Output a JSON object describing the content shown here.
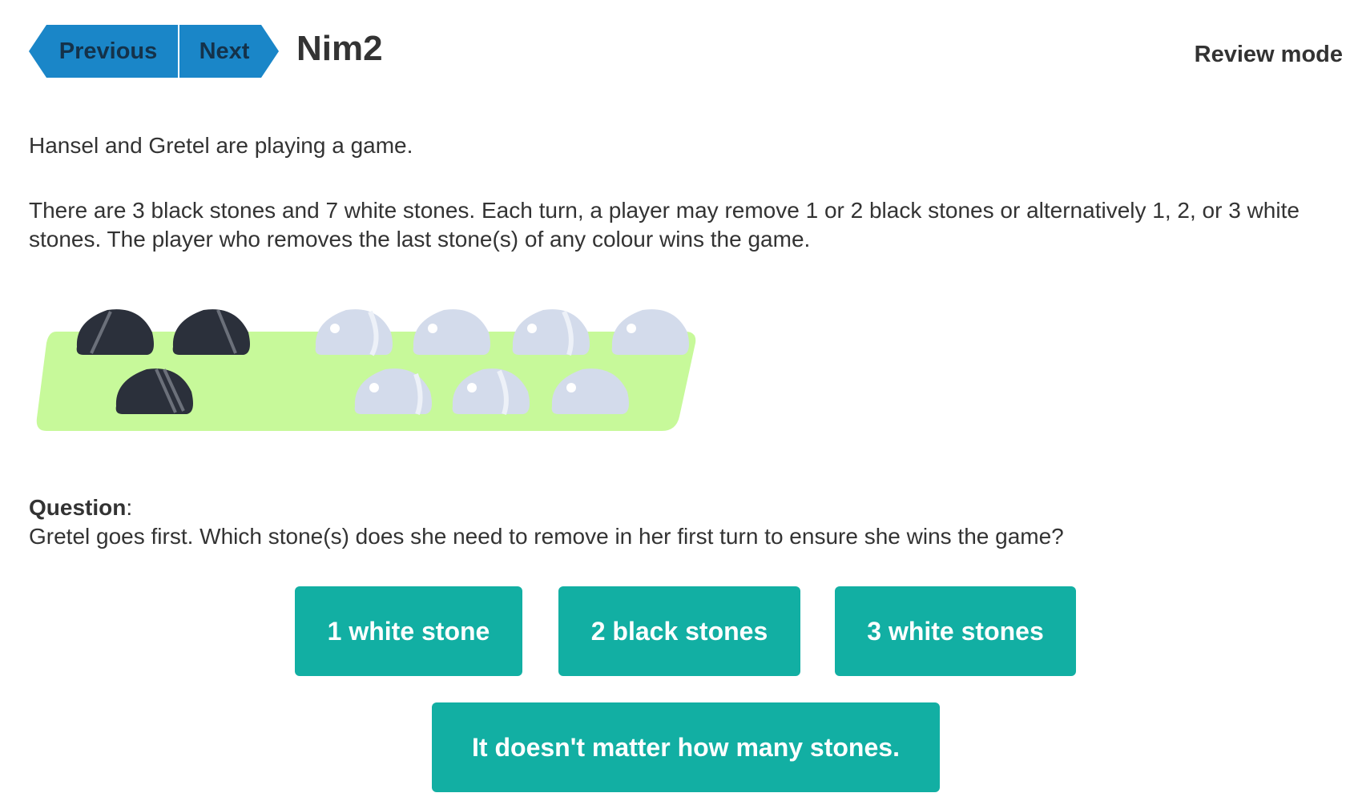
{
  "header": {
    "previous_label": "Previous",
    "next_label": "Next",
    "title": "Nim2",
    "mode_label": "Review mode"
  },
  "content": {
    "intro": "Hansel and Gretel are playing a game.",
    "rules": "There are 3 black stones and 7 white stones. Each turn, a player may remove 1 or 2 black stones or alternatively 1, 2, or 3 white stones. The player who removes the last stone(s) of any colour wins the game."
  },
  "illustration": {
    "black_stone_count": 3,
    "white_stone_count": 7,
    "colors": {
      "board": "#c7f99a",
      "black_stone": "#2b303b",
      "white_stone": "#d3dbeb"
    }
  },
  "question": {
    "label": "Question",
    "label_suffix": ":",
    "text": "Gretel goes first. Which stone(s) does she need to remove in her first turn to ensure she wins the game?"
  },
  "answers": [
    {
      "label": "1 white stone"
    },
    {
      "label": "2 black stones"
    },
    {
      "label": "3 white stones"
    },
    {
      "label": "It doesn't matter how many stones."
    }
  ],
  "colors": {
    "nav_button": "#1a86c8",
    "answer_button": "#12afa3",
    "text": "#333333"
  }
}
